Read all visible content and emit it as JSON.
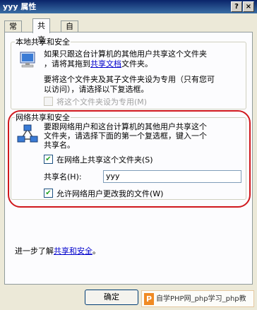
{
  "window": {
    "title": "yyy 属性",
    "help_label": "?",
    "close_label": "×"
  },
  "tabs": [
    {
      "label": "常规"
    },
    {
      "label": "共享"
    },
    {
      "label": "自定义"
    }
  ],
  "local": {
    "group_title": "本地共享和安全",
    "desc_line1": "如果只跟这台计算机的其他用户共享这个文件夹",
    "desc_line2_prefix": "，请将其拖到",
    "desc_link": "共享文档",
    "desc_line2_suffix": "文件夹。",
    "private_line1": "要将这个文件夹及其子文件夹设为专用（只有您可",
    "private_line2": "以访问），请选择以下复选框。",
    "private_checkbox_label": "将这个文件夹设为专用(M)",
    "private_checked": false
  },
  "network": {
    "group_title": "网络共享和安全",
    "desc_line1": "要跟网络用户和这台计算机的其他用户共享这个",
    "desc_line2": "文件夹，请选择下面的第一个复选框，键入一个",
    "desc_line3": "共享名。",
    "share_checkbox_label": "在网络上共享这个文件夹(S)",
    "share_checked": true,
    "share_name_label": "共享名(H):",
    "share_name_value": "yyy",
    "allow_change_label": "允许网络用户更改我的文件(W)",
    "allow_change_checked": true
  },
  "learn_more": {
    "prefix": "进一步了解",
    "link": "共享和安全",
    "suffix": "。"
  },
  "buttons": {
    "ok": "确定"
  },
  "watermark": {
    "logo": "P",
    "text": "自学PHP网_php学习_php教"
  }
}
